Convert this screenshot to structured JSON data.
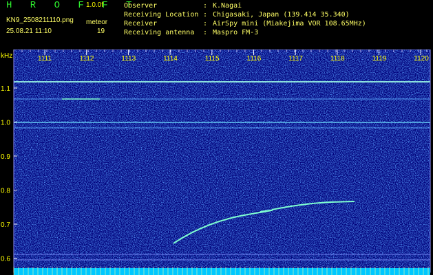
{
  "header": {
    "title": "H R O F F T",
    "version": "1.0.0f",
    "filename": "KN9_2508211110.png",
    "datetime": "25.08.21 11:10",
    "mode_label": "meteor",
    "count": "19",
    "meta": [
      {
        "key": "Observer",
        "sep": ":",
        "value": "K.Nagai"
      },
      {
        "key": "Receiving Location",
        "sep": ":",
        "value": "Chigasaki, Japan (139.414 35.340)"
      },
      {
        "key": "Receiver",
        "sep": ":",
        "value": "AirSpy mini (Miakejima VOR 108.65MHz)"
      },
      {
        "key": "Receiving antenna",
        "sep": ":",
        "value": "Maspro FM-3"
      }
    ]
  },
  "plot": {
    "y_unit": "kHz",
    "y_ticks": [
      "1.1",
      "1.0",
      "0.9",
      "0.8",
      "0.7",
      "0.6"
    ],
    "x_ticks": [
      "1111",
      "1112",
      "1113",
      "1114",
      "1115",
      "1116",
      "1117",
      "1118",
      "1119",
      "1120"
    ],
    "colors": {
      "background": "#00007a",
      "noise": "#2a5cff",
      "signal": "#7fffd0",
      "axis": "#ffffff",
      "tick_text": "#ffff00",
      "bottom_bar": "#00c8ff"
    }
  }
}
